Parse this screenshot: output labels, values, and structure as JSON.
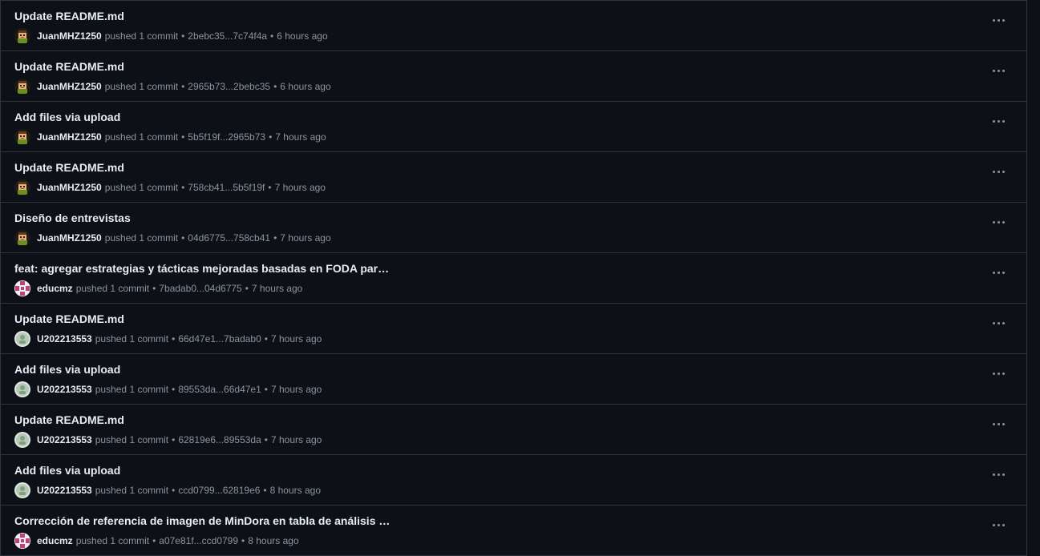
{
  "activities": [
    {
      "title": "Update README.md",
      "user": "JuanMHZ1250",
      "avatar": "juan",
      "action": "pushed 1 commit",
      "range": "2bebc35...7c74f4a",
      "time": "6 hours ago"
    },
    {
      "title": "Update README.md",
      "user": "JuanMHZ1250",
      "avatar": "juan",
      "action": "pushed 1 commit",
      "range": "2965b73...2bebc35",
      "time": "6 hours ago"
    },
    {
      "title": "Add files via upload",
      "user": "JuanMHZ1250",
      "avatar": "juan",
      "action": "pushed 1 commit",
      "range": "5b5f19f...2965b73",
      "time": "7 hours ago"
    },
    {
      "title": "Update README.md",
      "user": "JuanMHZ1250",
      "avatar": "juan",
      "action": "pushed 1 commit",
      "range": "758cb41...5b5f19f",
      "time": "7 hours ago"
    },
    {
      "title": "Diseño de entrevistas",
      "user": "JuanMHZ1250",
      "avatar": "juan",
      "action": "pushed 1 commit",
      "range": "04d6775...758cb41",
      "time": "7 hours ago"
    },
    {
      "title": "feat: agregar estrategias y tácticas mejoradas basadas en FODA para M...",
      "user": "educmz",
      "avatar": "educmz",
      "action": "pushed 1 commit",
      "range": "7badab0...04d6775",
      "time": "7 hours ago"
    },
    {
      "title": "Update README.md",
      "user": "U202213553",
      "avatar": "u2022",
      "action": "pushed 1 commit",
      "range": "66d47e1...7badab0",
      "time": "7 hours ago"
    },
    {
      "title": "Add files via upload",
      "user": "U202213553",
      "avatar": "u2022",
      "action": "pushed 1 commit",
      "range": "89553da...66d47e1",
      "time": "7 hours ago"
    },
    {
      "title": "Update README.md",
      "user": "U202213553",
      "avatar": "u2022",
      "action": "pushed 1 commit",
      "range": "62819e6...89553da",
      "time": "7 hours ago"
    },
    {
      "title": "Add files via upload",
      "user": "U202213553",
      "avatar": "u2022",
      "action": "pushed 1 commit",
      "range": "ccd0799...62819e6",
      "time": "8 hours ago"
    },
    {
      "title": "Corrección de referencia de imagen de MinDora en tabla de análisis co...",
      "user": "educmz",
      "avatar": "educmz",
      "action": "pushed 1 commit",
      "range": "a07e81f...ccd0799",
      "time": "8 hours ago"
    }
  ],
  "separator": "•",
  "colors": {
    "background": "#0d1117",
    "border": "#30363d",
    "text_primary": "#e6edf3",
    "text_muted": "#8b949e"
  },
  "icons": {
    "row_menu": "kebab-horizontal-icon",
    "avatar_types": [
      "pixel-avatar-juan",
      "identicon-educmz",
      "default-avatar-u2022"
    ]
  }
}
